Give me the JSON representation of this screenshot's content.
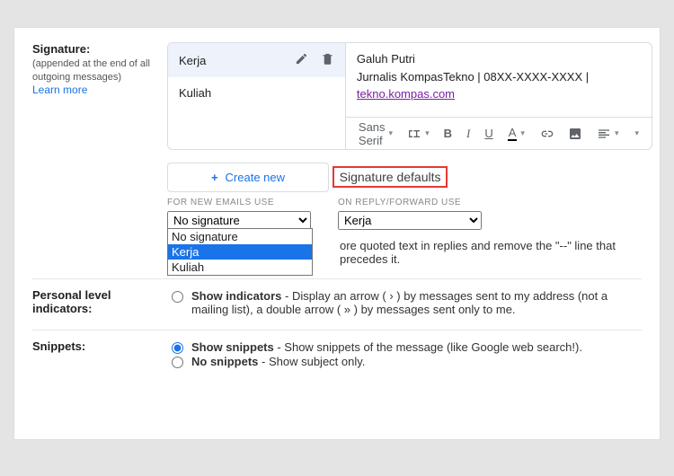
{
  "signature": {
    "label": "Signature:",
    "sub": "(appended at the end of all outgoing messages)",
    "learn_more": "Learn more",
    "items": [
      "Kerja",
      "Kuliah"
    ],
    "preview": {
      "line1": "Galuh Putri",
      "line2": "Jurnalis KompasTekno | 08XX-XXXX-XXXX | ",
      "link": "tekno.kompas.com"
    },
    "toolbar": {
      "font": "Sans Serif"
    },
    "create_new": "Create new",
    "defaults_title": "Signature defaults",
    "for_new": "FOR NEW EMAILS USE",
    "on_reply": "ON REPLY/FORWARD USE",
    "select1": "No signature",
    "options1": [
      "No signature",
      "Kerja",
      "Kuliah"
    ],
    "select2": "Kerja",
    "insert_checkbox": "ore quoted text in replies and remove the \"--\" line that precedes it."
  },
  "personal": {
    "label": "Personal level indicators:",
    "show_label": "Show indicators",
    "show_desc": " - Display an arrow ( › ) by messages sent to my address (not a mailing list), a double arrow ( » ) by messages sent only to me."
  },
  "snippets": {
    "label": "Snippets:",
    "show_label": "Show snippets",
    "show_desc": " - Show snippets of the message (like Google web search!).",
    "no_label": "No snippets",
    "no_desc": " - Show subject only."
  }
}
